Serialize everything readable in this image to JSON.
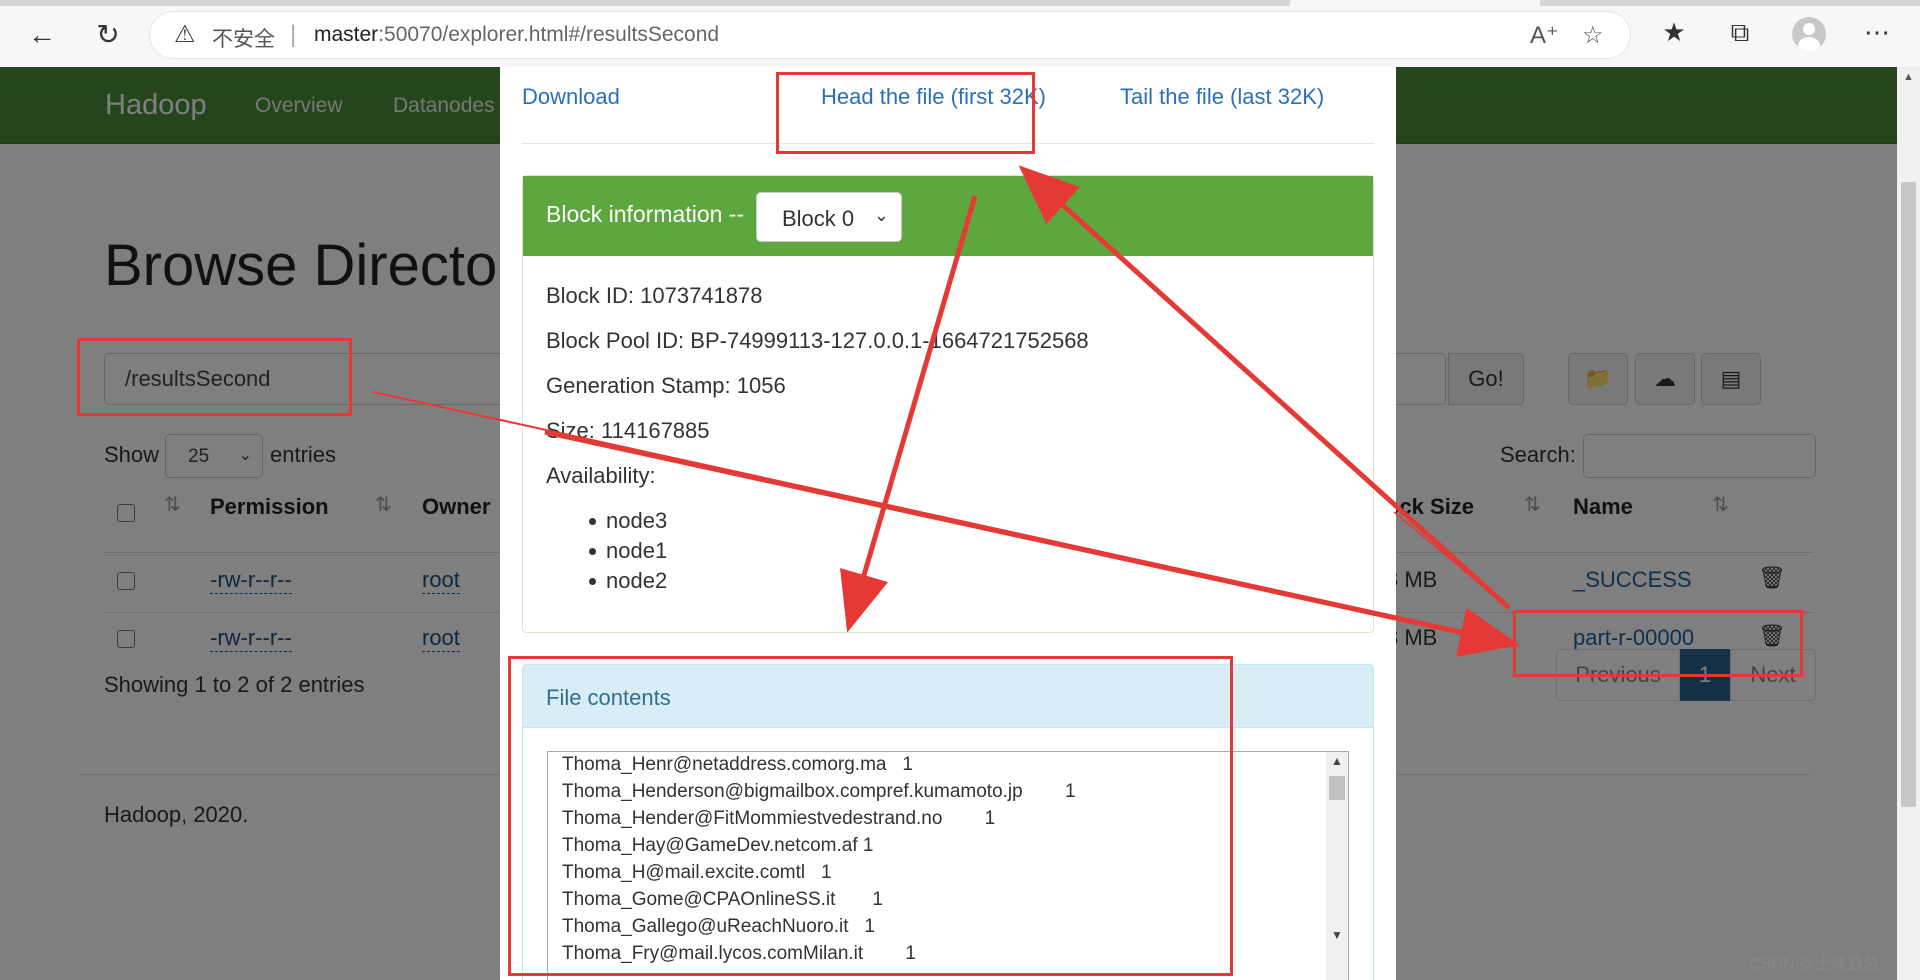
{
  "browser": {
    "security_label": "不安全",
    "url_host": "master",
    "url_rest": ":50070/explorer.html#/resultsSecond"
  },
  "page": {
    "brand": "Hadoop",
    "nav": [
      "Overview",
      "Datanodes"
    ],
    "title": "Browse Directo",
    "path": "/resultsSecond",
    "go_label": "Go!",
    "show_label": "Show",
    "entries_value": "25",
    "entries_label": "entries",
    "search_label": "Search:",
    "columns": [
      "Permission",
      "Owner",
      "ock Size",
      "Name"
    ],
    "rows": [
      {
        "permission": "-rw-r--r--",
        "owner": "root",
        "size": "8 MB",
        "name": "_SUCCESS"
      },
      {
        "permission": "-rw-r--r--",
        "owner": "root",
        "size": "8 MB",
        "name": "part-r-00000"
      }
    ],
    "showing": "Showing 1 to 2 of 2 entries",
    "pagination": {
      "previous": "Previous",
      "current": "1",
      "next": "Next"
    },
    "footer": "Hadoop, 2020."
  },
  "modal": {
    "links": {
      "download": "Download",
      "head": "Head the file (first 32K)",
      "tail": "Tail the file (last 32K)"
    },
    "block_title": "Block information --",
    "block_selected": "Block 0",
    "block_id": "Block ID: 1073741878",
    "block_pool": "Block Pool ID: BP-74999113-127.0.0.1-1664721752568",
    "generation": "Generation Stamp: 1056",
    "size": "Size: 114167885",
    "availability_label": "Availability:",
    "nodes": [
      "node3",
      "node1",
      "node2"
    ],
    "file_contents_title": "File contents",
    "file_lines": [
      "Thoma_Henr@netaddress.comorg.ma   1",
      "Thoma_Henderson@bigmailbox.compref.kumamoto.jp        1",
      "Thoma_Hender@FitMommiestvedestrand.no        1",
      "Thoma_Hay@GameDev.netcom.af 1",
      "Thoma_H@mail.excite.comtl   1",
      "Thoma_Gome@CPAOnlineSS.it       1",
      "Thoma_Gallego@uReachNuoro.it   1",
      "Thoma_Fry@mail.lycos.comMilan.it        1"
    ]
  },
  "watermark": "CSDN @土味霸总",
  "colors": {
    "navbar": "#4a8c3a",
    "block_header": "#5ea73e",
    "link": "#2a70b8",
    "annotation": "#e53935"
  }
}
